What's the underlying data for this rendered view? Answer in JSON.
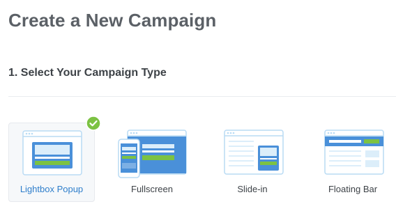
{
  "header": {
    "title": "Create a New Campaign"
  },
  "step": {
    "title": "1. Select Your Campaign Type"
  },
  "campaign_types": [
    {
      "label": "Lightbox Popup",
      "icon": "lightbox-popup-icon",
      "selected": true
    },
    {
      "label": "Fullscreen",
      "icon": "fullscreen-icon",
      "selected": false
    },
    {
      "label": "Slide-in",
      "icon": "slide-in-icon",
      "selected": false
    },
    {
      "label": "Floating Bar",
      "icon": "floating-bar-icon",
      "selected": false
    }
  ],
  "colors": {
    "title": "#5b6066",
    "selected_label": "#2e7ecb",
    "accent_blue": "#4a90d9",
    "light_blue": "#dceefa",
    "green": "#7cc243"
  }
}
